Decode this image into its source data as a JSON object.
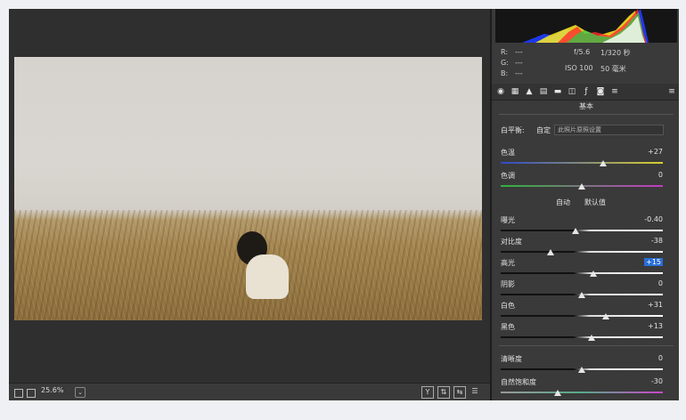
{
  "canvas": {
    "zoom_value": "25.6%"
  },
  "readouts": {
    "r_label": "R:",
    "r_value": "---",
    "g_label": "G:",
    "g_value": "---",
    "b_label": "B:",
    "b_value": "---",
    "aperture": "f/5.6",
    "shutter": "1/320 秒",
    "iso": "ISO 100",
    "focal": "50 毫米"
  },
  "panel": {
    "section_title": "基本",
    "white_balance_label": "白平衡:",
    "white_balance_value": "自定",
    "white_balance_placeholder": "此照片原照设置",
    "auto_label": "自动",
    "default_label": "默认值"
  },
  "sliders": [
    {
      "label": "色温",
      "value": "+27",
      "level": 0.63,
      "track": "temp"
    },
    {
      "label": "色调",
      "value": "0",
      "level": 0.5,
      "track": "tint"
    },
    {
      "label": "曝光",
      "value": "-0.40",
      "level": 0.46,
      "track": "gray"
    },
    {
      "label": "对比度",
      "value": "-38",
      "level": 0.31,
      "track": "gray"
    },
    {
      "label": "高光",
      "value": "+15",
      "level": 0.57,
      "track": "gray",
      "highlight": true
    },
    {
      "label": "阴影",
      "value": "0",
      "level": 0.5,
      "track": "gray"
    },
    {
      "label": "白色",
      "value": "+31",
      "level": 0.65,
      "track": "gray"
    },
    {
      "label": "黑色",
      "value": "+13",
      "level": 0.56,
      "track": "gray"
    },
    {
      "label": "清晰度",
      "value": "0",
      "level": 0.5,
      "track": "gray"
    },
    {
      "label": "自然饱和度",
      "value": "-30",
      "level": 0.35,
      "track": "sat"
    }
  ],
  "icons": {
    "zoom_dropdown": "chevron-down-icon",
    "view_y": "Y",
    "compare": "compare-icon",
    "swap": "swap-icon",
    "settings": "sliders-icon"
  },
  "colors": {
    "accent": "#2a6fd6",
    "panel_bg": "#3a3a3a",
    "canvas_bg": "#2f2f2f"
  }
}
